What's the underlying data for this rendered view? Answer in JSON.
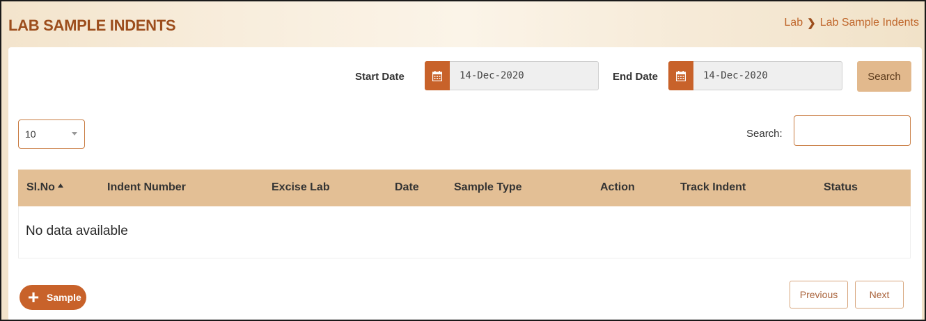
{
  "header": {
    "title": "LAB SAMPLE INDENTS",
    "breadcrumb": [
      "Lab",
      "Lab Sample Indents"
    ]
  },
  "filters": {
    "start_date_label": "Start Date",
    "start_date_value": "14-Dec-2020",
    "end_date_label": "End Date",
    "end_date_value": "14-Dec-2020",
    "search_button": "Search"
  },
  "table_controls": {
    "page_length": "10",
    "search_label": "Search:",
    "search_value": ""
  },
  "table": {
    "columns": [
      "Sl.No",
      "Indent Number",
      "Excise Lab",
      "Date",
      "Sample Type",
      "Action",
      "Track Indent",
      "Status"
    ],
    "sorted_column": "Sl.No",
    "empty_message": "No data available"
  },
  "footer": {
    "add_button": "Sample",
    "previous": "Previous",
    "next": "Next"
  },
  "colors": {
    "accent": "#c8622a",
    "header_bg": "#e3bf95",
    "title": "#9c4d1c"
  },
  "icons": {
    "calendar": "calendar-icon",
    "breadcrumb_separator": "chevron-right-icon",
    "sort": "sort-up-icon",
    "add": "plus-icon"
  }
}
